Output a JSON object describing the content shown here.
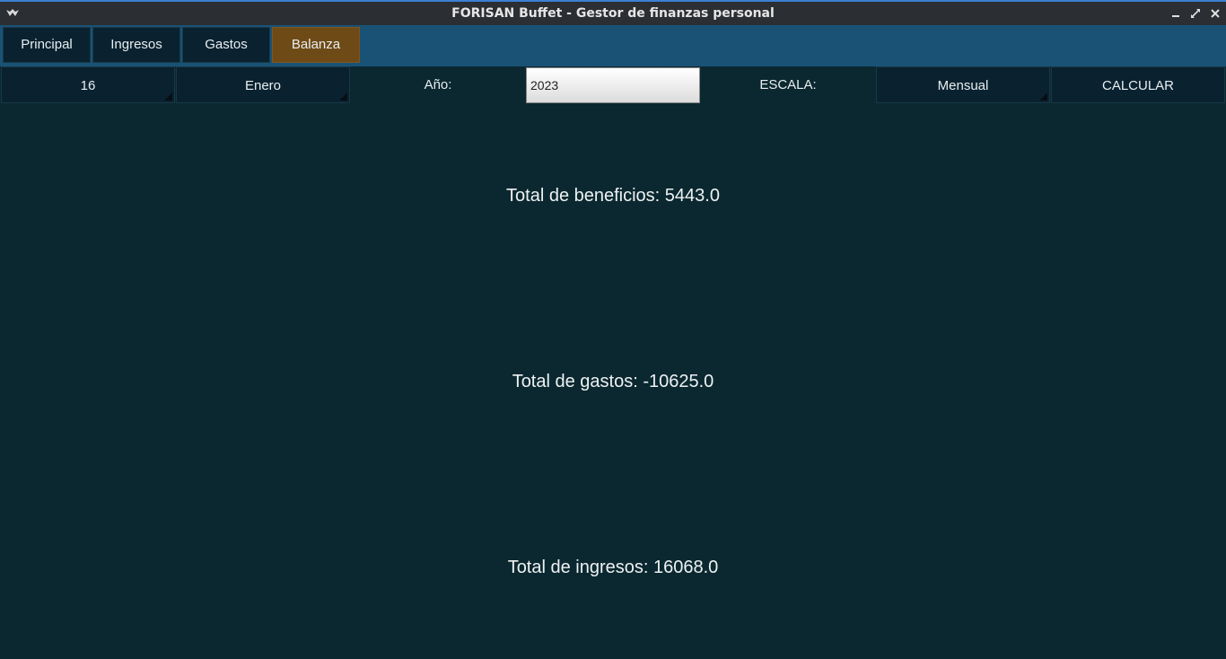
{
  "window": {
    "title": "FORISAN Buffet - Gestor de finanzas personal",
    "icons": {
      "app": "app-menu-icon",
      "minimize": "minimize-icon",
      "maximize": "maximize-icon",
      "close": "close-icon"
    }
  },
  "tabs": [
    {
      "label": "Principal"
    },
    {
      "label": "Ingresos"
    },
    {
      "label": "Gastos"
    },
    {
      "label": "Balanza",
      "active": true
    }
  ],
  "controls": {
    "day": "16",
    "month": "Enero",
    "year_label": "Año:",
    "year_value": "2023",
    "scale_label": "ESCALA:",
    "scale_value": "Mensual",
    "calculate": "CALCULAR"
  },
  "results": {
    "beneficios": "Total de beneficios: 5443.0",
    "gastos": "Total de gastos: -10625.0",
    "ingresos": "Total de ingresos: 16068.0"
  },
  "colors": {
    "background": "#0b2830",
    "tabbar": "#1a5276",
    "active_tab": "#6e4a16",
    "button": "#0a2230",
    "titlebar": "#2b2e33",
    "titlebar_accent": "#3d7fd1"
  }
}
